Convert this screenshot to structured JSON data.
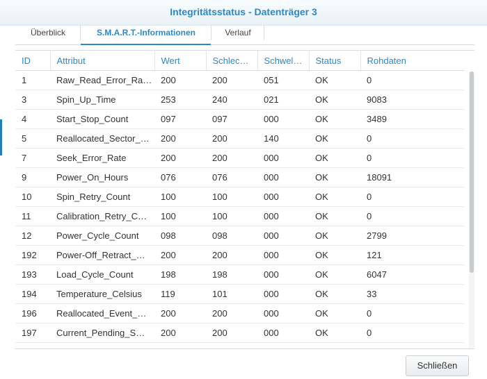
{
  "window": {
    "title": "Integritätsstatus - Datenträger 3"
  },
  "tabs": [
    {
      "label": "Überblick"
    },
    {
      "label": "S.M.A.R.T.-Informationen"
    },
    {
      "label": "Verlauf"
    }
  ],
  "table": {
    "columns": [
      "ID",
      "Attribut",
      "Wert",
      "Schlec…",
      "Schwel…",
      "Status",
      "Rohdaten"
    ],
    "rows": [
      [
        "1",
        "Raw_Read_Error_Ra…",
        "200",
        "200",
        "051",
        "OK",
        "0"
      ],
      [
        "3",
        "Spin_Up_Time",
        "253",
        "240",
        "021",
        "OK",
        "9083"
      ],
      [
        "4",
        "Start_Stop_Count",
        "097",
        "097",
        "000",
        "OK",
        "3489"
      ],
      [
        "5",
        "Reallocated_Sector_…",
        "200",
        "200",
        "140",
        "OK",
        "0"
      ],
      [
        "7",
        "Seek_Error_Rate",
        "200",
        "200",
        "000",
        "OK",
        "0"
      ],
      [
        "9",
        "Power_On_Hours",
        "076",
        "076",
        "000",
        "OK",
        "18091"
      ],
      [
        "10",
        "Spin_Retry_Count",
        "100",
        "100",
        "000",
        "OK",
        "0"
      ],
      [
        "11",
        "Calibration_Retry_C…",
        "100",
        "100",
        "000",
        "OK",
        "0"
      ],
      [
        "12",
        "Power_Cycle_Count",
        "098",
        "098",
        "000",
        "OK",
        "2799"
      ],
      [
        "192",
        "Power-Off_Retract_…",
        "200",
        "200",
        "000",
        "OK",
        "121"
      ],
      [
        "193",
        "Load_Cycle_Count",
        "198",
        "198",
        "000",
        "OK",
        "6047"
      ],
      [
        "194",
        "Temperature_Celsius",
        "119",
        "101",
        "000",
        "OK",
        "33"
      ],
      [
        "196",
        "Reallocated_Event_…",
        "200",
        "200",
        "000",
        "OK",
        "0"
      ],
      [
        "197",
        "Current_Pending_S…",
        "200",
        "200",
        "000",
        "OK",
        "0"
      ]
    ]
  },
  "footer": {
    "close_label": "Schließen"
  },
  "colors": {
    "accent": "#2b89c8"
  }
}
